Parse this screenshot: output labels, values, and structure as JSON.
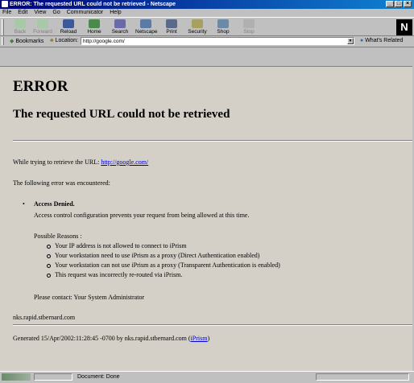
{
  "window": {
    "title": "ERROR: The requested URL could not be retrieved - Netscape"
  },
  "menu": [
    "File",
    "Edit",
    "View",
    "Go",
    "Communicator",
    "Help"
  ],
  "toolbar": [
    {
      "label": "Back",
      "icon": "back-arrow-icon",
      "enabled": false
    },
    {
      "label": "Forward",
      "icon": "forward-arrow-icon",
      "enabled": false
    },
    {
      "label": "Reload",
      "icon": "reload-icon",
      "enabled": true
    },
    {
      "label": "Home",
      "icon": "home-icon",
      "enabled": true
    },
    {
      "label": "Search",
      "icon": "search-icon",
      "enabled": true
    },
    {
      "label": "Netscape",
      "icon": "netscape-icon",
      "enabled": true
    },
    {
      "label": "Print",
      "icon": "print-icon",
      "enabled": true
    },
    {
      "label": "Security",
      "icon": "security-icon",
      "enabled": true
    },
    {
      "label": "Shop",
      "icon": "shop-icon",
      "enabled": true
    },
    {
      "label": "Stop",
      "icon": "stop-icon",
      "enabled": false
    }
  ],
  "location": {
    "bookmarks": "Bookmarks",
    "label": "Location:",
    "url": "http://google.com/",
    "related": "What's Related"
  },
  "page": {
    "heading": "ERROR",
    "subheading": "The requested URL could not be retrieved",
    "retrieve_prefix": "While trying to retrieve the URL:",
    "retrieve_url": "http://google.com/",
    "error_intro": "The following error was encountered:",
    "error_title": "Access Denied.",
    "error_desc": "Access control configuration prevents your request from being allowed at this time.",
    "reasons_title": "Possible Reasons :",
    "reasons": [
      "Your IP address is not allowed to connect to iPrism",
      "Your workstation need to use iPrism as a proxy (Direct Authentication enabled)",
      "Your workstation can not use iPrism as a proxy (Transparent Authentication is enabled)",
      "This request was incorrectly re-routed via iPrism."
    ],
    "contact": "Please contact: Your System Administrator",
    "host": "nks.rapid.stbernard.com",
    "generated": "Generated 15/Apr/2002:11:28:45 -0700 by nks.rapid.stbernard.com",
    "generated_link": "iPrism"
  },
  "status": {
    "text": "Document: Done"
  },
  "colors": {
    "title_start": "#00007b",
    "title_end": "#1084d0",
    "link": "#0000cc",
    "page_bg": "#d4d0c8"
  }
}
